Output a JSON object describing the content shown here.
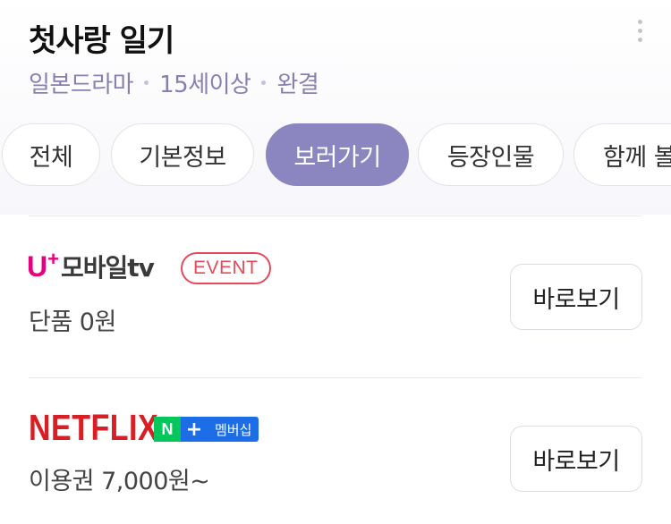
{
  "header": {
    "title": "첫사랑 일기",
    "meta": {
      "genre": "일본드라마",
      "rating": "15세이상",
      "status": "완결"
    }
  },
  "tabs": [
    {
      "label": "전체",
      "active": false
    },
    {
      "label": "기본정보",
      "active": false
    },
    {
      "label": "보러가기",
      "active": true
    },
    {
      "label": "등장인물",
      "active": false
    },
    {
      "label": "함께 볼",
      "active": false
    }
  ],
  "providers": [
    {
      "logo_letter": "U",
      "logo_plus": "+",
      "logo_name": "모바일tv",
      "badge": "EVENT",
      "price": "단품 0원",
      "button": "바로보기"
    },
    {
      "logo_text": "NETFLIX",
      "badge_n": "N",
      "badge_plus": "+",
      "badge_membership": "멤버십",
      "price": "이용권 7,000원~",
      "button": "바로보기"
    }
  ],
  "colors": {
    "active_tab": "#8b86c0",
    "meta_text": "#8a7fb0",
    "uplus_brand": "#e6007e",
    "event_badge": "#e34b5a",
    "netflix_red": "#d81f26",
    "naver_green": "#03c75a",
    "membership_blue": "#1d6ee6"
  }
}
